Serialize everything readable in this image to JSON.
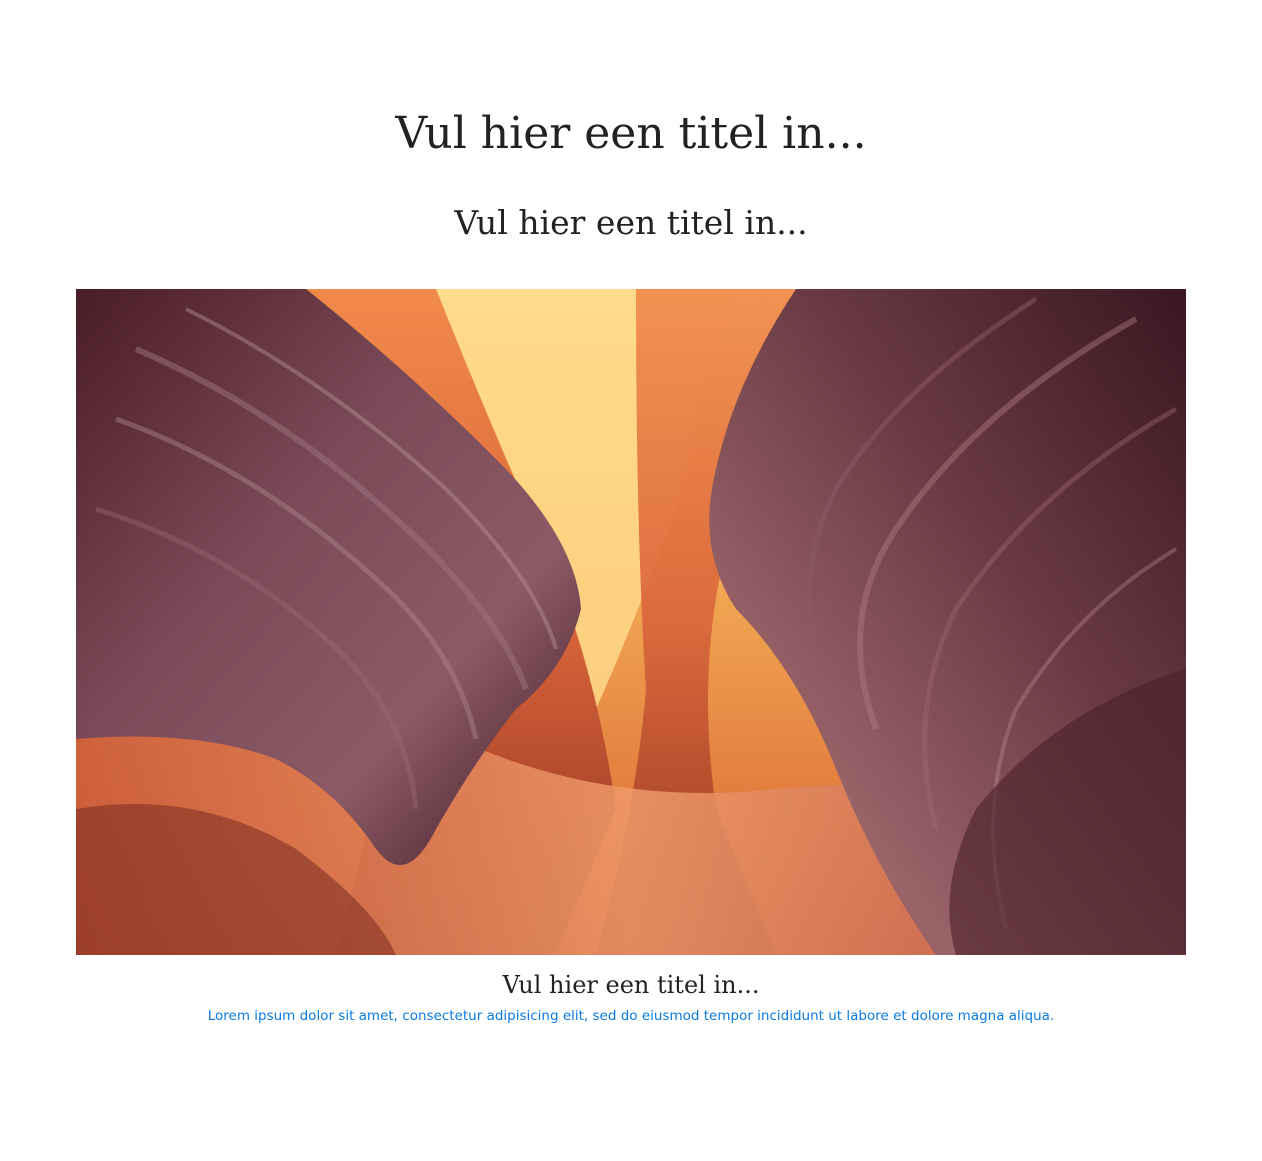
{
  "header": {
    "title": "Vul hier een titel in...",
    "subtitle": "Vul hier een titel in..."
  },
  "image": {
    "icon": "canyon-photo",
    "colors": {
      "sky": "#f6b45a",
      "glow": "#ffd98a",
      "rock_orange": "#d9643a",
      "rock_deep": "#5a2430",
      "rock_dark": "#3a1620",
      "rock_mauve": "#8c5a66"
    }
  },
  "caption": {
    "title": "Vul hier een titel in...",
    "text": "Lorem ipsum dolor sit amet, consectetur adipisicing elit, sed do eiusmod tempor incididunt ut labore et dolore magna aliqua.",
    "link_color": "#0a7be0"
  }
}
